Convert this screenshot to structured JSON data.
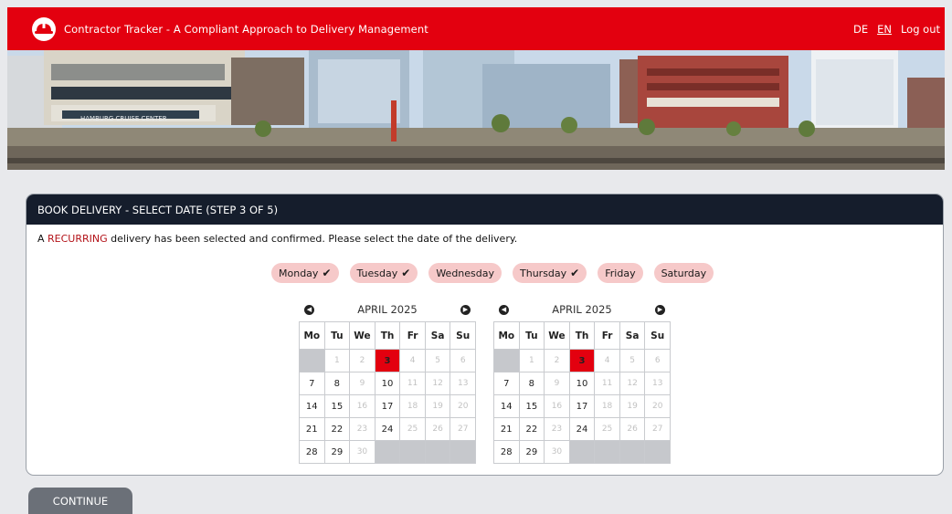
{
  "header": {
    "title": "Contractor Tracker - A Compliant Approach to Delivery Management",
    "lang_de": "DE",
    "lang_en": "EN",
    "logout": "Log out"
  },
  "banner": {
    "sign_text": "HAMBURG CRUISE CENTER"
  },
  "card": {
    "title": "BOOK DELIVERY - SELECT DATE (STEP 3 OF 5)",
    "instruction_prefix": "A ",
    "instruction_highlight": "RECURRING",
    "instruction_suffix": " delivery has been selected and confirmed. Please select the date of the delivery."
  },
  "weekdays": [
    {
      "label": "Monday",
      "checked": true
    },
    {
      "label": "Tuesday",
      "checked": true
    },
    {
      "label": "Wednesday",
      "checked": false
    },
    {
      "label": "Thursday",
      "checked": true
    },
    {
      "label": "Friday",
      "checked": false
    },
    {
      "label": "Saturday",
      "checked": false
    }
  ],
  "calendars": [
    {
      "month": "APRIL 2025",
      "headers": [
        "Mo",
        "Tu",
        "We",
        "Th",
        "Fr",
        "Sa",
        "Su"
      ],
      "weeks": [
        [
          "",
          "1",
          "2",
          "3",
          "4",
          "5",
          "6"
        ],
        [
          "7",
          "8",
          "9",
          "10",
          "11",
          "12",
          "13"
        ],
        [
          "14",
          "15",
          "16",
          "17",
          "18",
          "19",
          "20"
        ],
        [
          "21",
          "22",
          "23",
          "24",
          "25",
          "26",
          "27"
        ],
        [
          "28",
          "29",
          "30",
          "",
          "",
          "",
          ""
        ]
      ],
      "selected": "3"
    },
    {
      "month": "APRIL 2025",
      "headers": [
        "Mo",
        "Tu",
        "We",
        "Th",
        "Fr",
        "Sa",
        "Su"
      ],
      "weeks": [
        [
          "",
          "1",
          "2",
          "3",
          "4",
          "5",
          "6"
        ],
        [
          "7",
          "8",
          "9",
          "10",
          "11",
          "12",
          "13"
        ],
        [
          "14",
          "15",
          "16",
          "17",
          "18",
          "19",
          "20"
        ],
        [
          "21",
          "22",
          "23",
          "24",
          "25",
          "26",
          "27"
        ],
        [
          "28",
          "29",
          "30",
          "",
          "",
          "",
          ""
        ]
      ],
      "selected": "3"
    }
  ],
  "calendar_rules": {
    "available_days": [
      "7",
      "8",
      "10",
      "14",
      "15",
      "17",
      "21",
      "22",
      "24",
      "28",
      "29"
    ]
  },
  "icons": {
    "prev": "chevron-left-circle-icon",
    "next": "chevron-right-circle-icon",
    "check": "check-icon",
    "logo": "hardhat-icon"
  },
  "colors": {
    "brand_red": "#e3000f",
    "header_dark": "#151d2c",
    "chip_bg": "#f6c9c9",
    "button_gray": "#6b7078"
  },
  "actions": {
    "continue_label": "CONTINUE"
  }
}
